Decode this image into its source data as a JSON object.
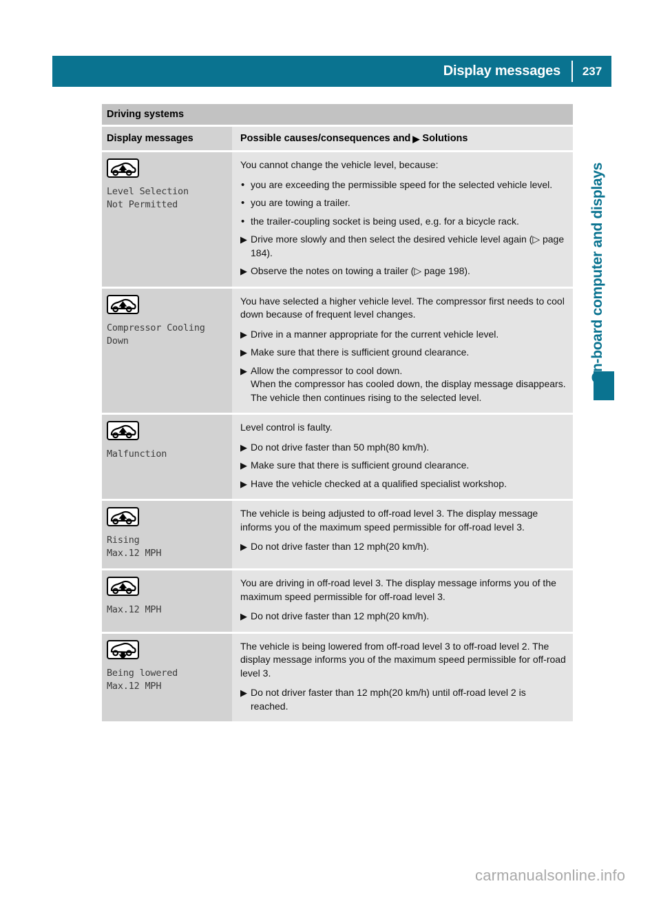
{
  "header": {
    "title": "Display messages",
    "page_number": "237",
    "accent_color": "#0a7390"
  },
  "sidebar": {
    "chapter_label": "On-board computer and displays"
  },
  "section": {
    "title": "Driving systems"
  },
  "table": {
    "columns": {
      "left": "Display messages",
      "right_prefix": "Possible causes/consequences and",
      "right_marker": "▶",
      "right_suffix": "Solutions"
    },
    "rows": [
      {
        "icon": "vehicle-level-up-icon",
        "message": "Level Selection\nNot Permitted",
        "intro": "You cannot change the vehicle level, because:",
        "items": [
          {
            "type": "cause",
            "marker": "•",
            "text": "you are exceeding the permissible speed for the selected vehicle level."
          },
          {
            "type": "cause",
            "marker": "•",
            "text": "you are towing a trailer."
          },
          {
            "type": "cause",
            "marker": "•",
            "text": "the trailer-coupling socket is being used, e.g. for a bicycle rack."
          },
          {
            "type": "solution",
            "marker": "▶",
            "text": "Drive more slowly and then select the desired vehicle level again (▷ page 184)."
          },
          {
            "type": "solution",
            "marker": "▶",
            "text": "Observe the notes on towing a trailer (▷ page 198)."
          }
        ]
      },
      {
        "icon": "vehicle-level-up-icon",
        "message": "Compressor Cooling\nDown",
        "intro": "You have selected a higher vehicle level. The compressor first needs to cool down because of frequent level changes.",
        "items": [
          {
            "type": "solution",
            "marker": "▶",
            "text": "Drive in a manner appropriate for the current vehicle level."
          },
          {
            "type": "solution",
            "marker": "▶",
            "text": "Make sure that there is sufficient ground clearance."
          },
          {
            "type": "solution",
            "marker": "▶",
            "text": "Allow the compressor to cool down.",
            "sub": "When the compressor has cooled down, the display message disappears. The vehicle then continues rising to the selected level."
          }
        ]
      },
      {
        "icon": "vehicle-level-up-icon",
        "message": "Malfunction",
        "intro": "Level control is faulty.",
        "items": [
          {
            "type": "solution",
            "marker": "▶",
            "text": "Do not drive faster than 50 mph(80 km/h)."
          },
          {
            "type": "solution",
            "marker": "▶",
            "text": "Make sure that there is sufficient ground clearance."
          },
          {
            "type": "solution",
            "marker": "▶",
            "text": "Have the vehicle checked at a qualified specialist workshop."
          }
        ]
      },
      {
        "icon": "vehicle-level-up-icon",
        "message": "Rising\nMax.12 MPH",
        "intro": "The vehicle is being adjusted to off-road level 3. The display message informs you of the maximum speed permissible for off-road level 3.",
        "items": [
          {
            "type": "solution",
            "marker": "▶",
            "text": "Do not drive faster than 12 mph(20 km/h)."
          }
        ]
      },
      {
        "icon": "vehicle-level-up-icon",
        "message": "Max.12 MPH",
        "intro": "You are driving in off-road level 3. The display message informs you of the maximum speed permissible for off-road level 3.",
        "items": [
          {
            "type": "solution",
            "marker": "▶",
            "text": "Do not drive faster than 12 mph(20 km/h)."
          }
        ]
      },
      {
        "icon": "vehicle-level-down-icon",
        "message": "Being lowered\nMax.12 MPH",
        "intro": "The vehicle is being lowered from off-road level 3 to off-road level 2. The display message informs you of the maximum speed permissible for off-road level 3.",
        "items": [
          {
            "type": "solution",
            "marker": "▶",
            "text": "Do not driver faster than 12 mph(20 km/h) until off-road level 2 is reached."
          }
        ]
      }
    ]
  },
  "footer": {
    "watermark": "carmanualsonline.info"
  }
}
